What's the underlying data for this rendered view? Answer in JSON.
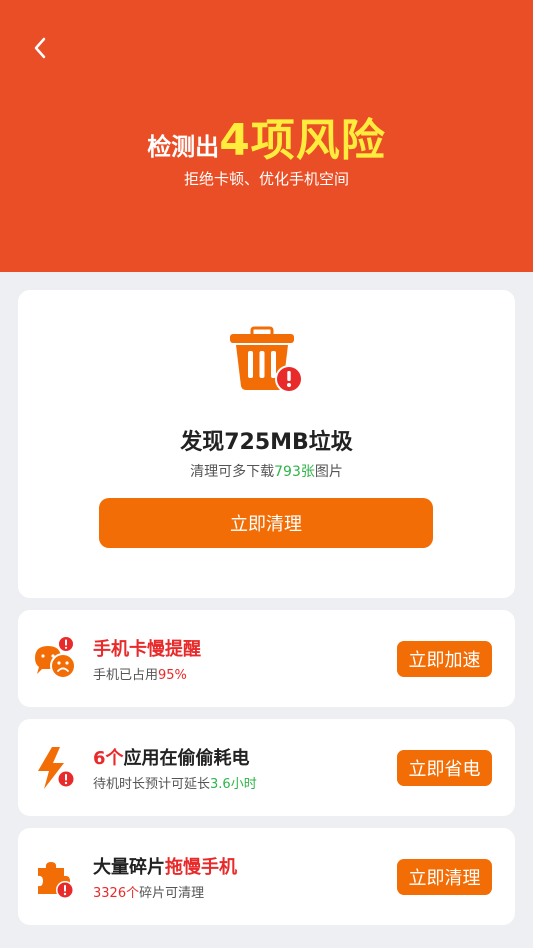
{
  "header": {
    "title_prefix": "检测出",
    "title_highlight": "4项风险",
    "subtitle": "拒绝卡顿、优化手机空间"
  },
  "junk_card": {
    "title": "发现725MB垃圾",
    "sub_prefix": "清理可多下载",
    "sub_count": "793张",
    "sub_suffix": "图片",
    "button": "立即清理"
  },
  "items": [
    {
      "title_black": "",
      "title_red": "手机卡慢提醒",
      "sub_prefix": "手机已占用",
      "sub_value": "95%",
      "sub_suffix": "",
      "button": "立即加速",
      "icon": "chat-warning-icon"
    },
    {
      "title_red": "6个",
      "title_black": "应用在偷偷耗电",
      "sub_prefix": "待机时长预计可延长",
      "sub_value": "3.6小时",
      "sub_suffix": "",
      "button": "立即省电",
      "icon": "lightning-warning-icon"
    },
    {
      "title_black": "大量碎片",
      "title_red": "拖慢手机",
      "sub_value": "3326个",
      "sub_suffix": "碎片可清理",
      "button": "立即清理",
      "icon": "puzzle-warning-icon"
    }
  ],
  "colors": {
    "header": "#ea4e26",
    "highlight": "#ffec3d",
    "button": "#f26d05",
    "red_text": "#e82a2a",
    "green_text": "#2fb44a"
  }
}
